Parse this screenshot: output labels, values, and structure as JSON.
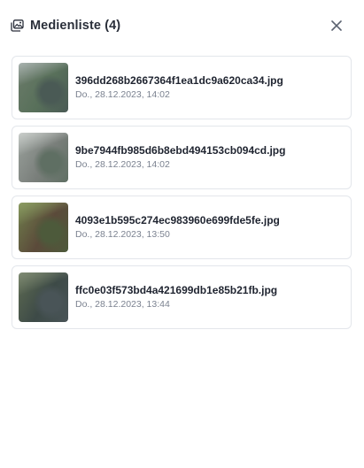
{
  "header": {
    "icon": "image-gallery-icon",
    "title": "Medienliste (4)",
    "close_icon": "close-icon"
  },
  "media": [
    {
      "filename": "396dd268b2667364f1ea1dc9a620ca34.jpg",
      "date": "Do., 28.12.2023, 14:02",
      "colors": [
        "#6b7b6a",
        "#4a5a55",
        "#a9b3b0",
        "#58705a"
      ]
    },
    {
      "filename": "9be7944fb985d6b8ebd494153cb094cd.jpg",
      "date": "Do., 28.12.2023, 14:02",
      "colors": [
        "#9aa19c",
        "#5f6f63",
        "#c9cdca",
        "#7a7f7b"
      ]
    },
    {
      "filename": "4093e1b595c274ec983960e699fde5fe.jpg",
      "date": "Do., 28.12.2023, 13:50",
      "colors": [
        "#6f7e4c",
        "#4d5a3b",
        "#8b9a62",
        "#5b4a3a"
      ]
    },
    {
      "filename": "ffc0e03f573bd4a421699db1e85b21fb.jpg",
      "date": "Do., 28.12.2023, 13:44",
      "colors": [
        "#5e6b52",
        "#495457",
        "#7e8a74",
        "#3d4a47"
      ]
    }
  ]
}
